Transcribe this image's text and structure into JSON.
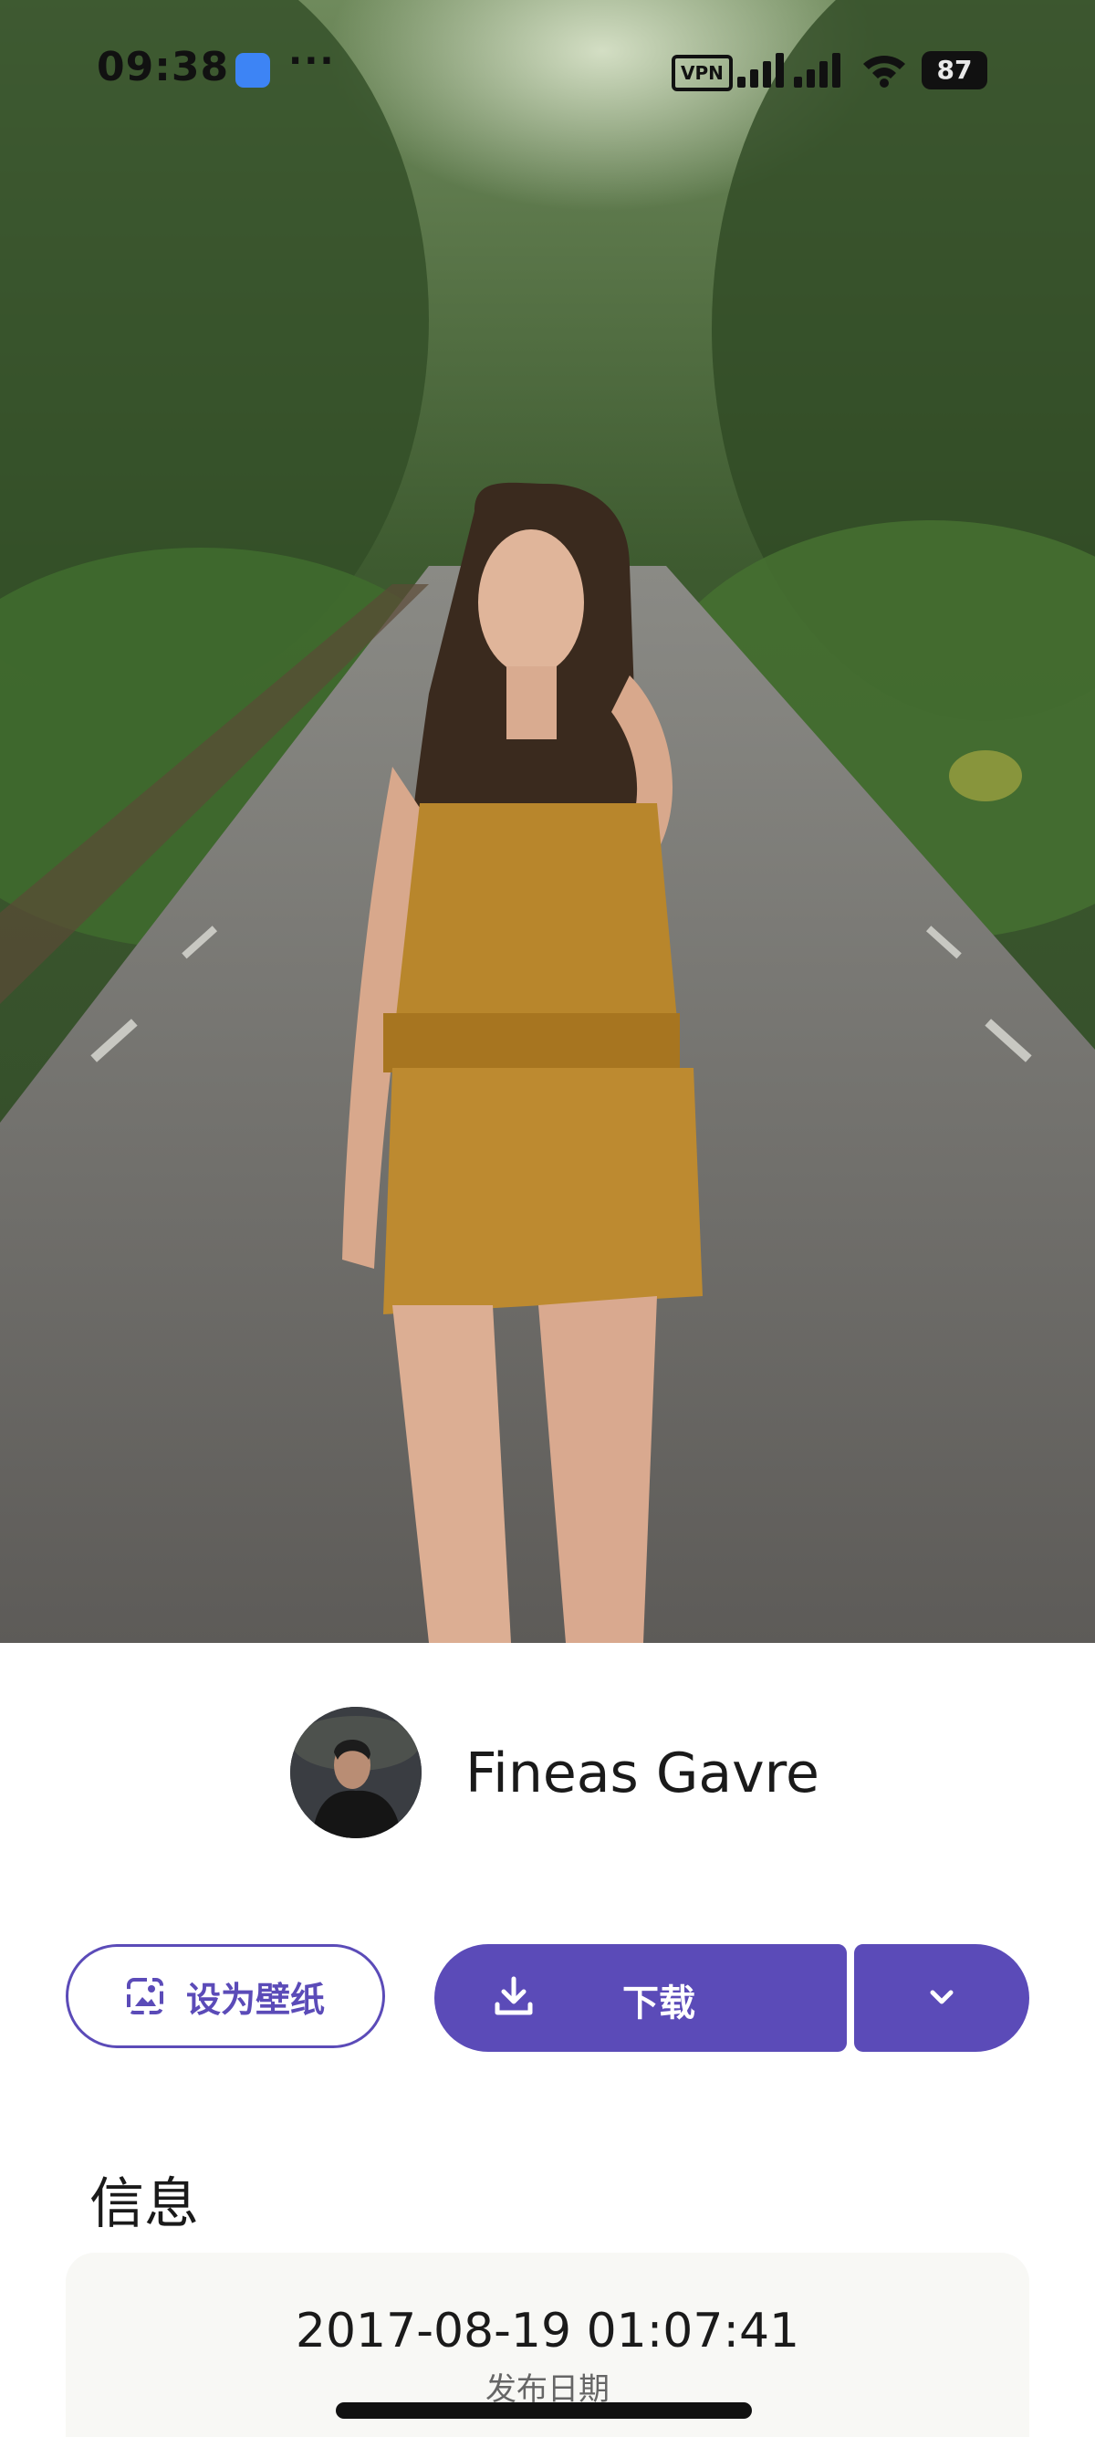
{
  "status_bar": {
    "time": "09:38",
    "more": "···",
    "vpn": "VPN",
    "battery": "87"
  },
  "author": {
    "name": "Fineas Gavre"
  },
  "actions": {
    "set_wallpaper_label": "设为壁纸",
    "download_label": "下载"
  },
  "info": {
    "section_title": "信息",
    "published_value": "2017-08-19 01:07:41",
    "published_label": "发布日期"
  },
  "colors": {
    "accent": "#5b4bb8",
    "card_bg": "#f8f8f5"
  }
}
